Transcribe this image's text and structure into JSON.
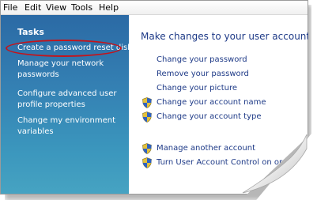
{
  "menu": {
    "file": "File",
    "edit": "Edit",
    "view": "View",
    "tools": "Tools",
    "help": "Help"
  },
  "sidebar": {
    "heading": "Tasks",
    "links": [
      "Create a password reset disk",
      "Manage your network passwords",
      "Configure advanced user profile properties",
      "Change my environment variables"
    ]
  },
  "main": {
    "title": "Make changes to your user account",
    "links": [
      "Change your password",
      "Remove your password",
      "Change your picture",
      "Change your account name",
      "Change your account type",
      "Manage another account",
      "Turn User Account Control on or off"
    ]
  },
  "colors": {
    "sidebar_top": "#2b6aa5",
    "sidebar_bottom": "#46a3c2",
    "link": "#1e3a87",
    "highlight": "#c4141b"
  },
  "icons": {
    "shield": "uac-shield-icon"
  }
}
